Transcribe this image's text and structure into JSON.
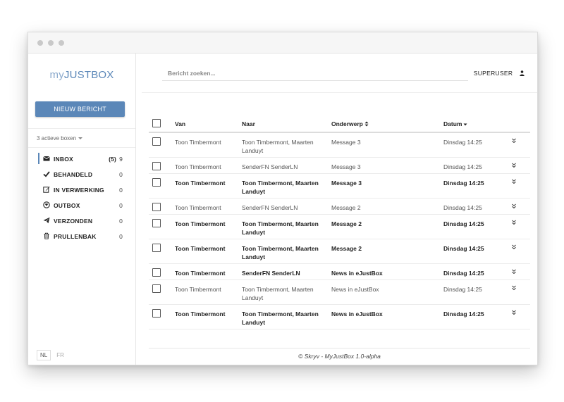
{
  "sidebar": {
    "logo_prefix": "my",
    "logo_main": "JUSTBOX",
    "new_button": "NIEUW BERICHT",
    "boxes_label": "3 actieve boxen",
    "items": [
      {
        "label": "INBOX",
        "unread": "(5)",
        "count": "9",
        "icon": "envelope-icon"
      },
      {
        "label": "BEHANDELD",
        "unread": "",
        "count": "0",
        "icon": "check-icon"
      },
      {
        "label": "IN VERWERKING",
        "unread": "",
        "count": "0",
        "icon": "edit-icon"
      },
      {
        "label": "OUTBOX",
        "unread": "",
        "count": "0",
        "icon": "arrow-circle-icon"
      },
      {
        "label": "VERZONDEN",
        "unread": "",
        "count": "0",
        "icon": "paper-plane-icon"
      },
      {
        "label": "PRULLENBAK",
        "unread": "",
        "count": "0",
        "icon": "trash-icon"
      }
    ],
    "languages": [
      "NL",
      "FR"
    ]
  },
  "header": {
    "search_placeholder": "Bericht zoeken...",
    "user": "SUPERUSER"
  },
  "table": {
    "columns": {
      "from": "Van",
      "to": "Naar",
      "subject": "Onderwerp",
      "date": "Datum"
    },
    "rows": [
      {
        "from": "Toon Timbermont",
        "to": "Toon Timbermont, Maarten Landuyt",
        "subject": "Message 3",
        "date": "Dinsdag 14:25",
        "unread": false
      },
      {
        "from": "Toon Timbermont",
        "to": "SenderFN SenderLN",
        "subject": "Message 3",
        "date": "Dinsdag 14:25",
        "unread": false
      },
      {
        "from": "Toon Timbermont",
        "to": "Toon Timbermont, Maarten Landuyt",
        "subject": "Message 3",
        "date": "Dinsdag 14:25",
        "unread": true
      },
      {
        "from": "Toon Timbermont",
        "to": "SenderFN SenderLN",
        "subject": "Message 2",
        "date": "Dinsdag 14:25",
        "unread": false
      },
      {
        "from": "Toon Timbermont",
        "to": "Toon Timbermont, Maarten Landuyt",
        "subject": "Message 2",
        "date": "Dinsdag 14:25",
        "unread": true
      },
      {
        "from": "Toon Timbermont",
        "to": "Toon Timbermont, Maarten Landuyt",
        "subject": "Message 2",
        "date": "Dinsdag 14:25",
        "unread": true
      },
      {
        "from": "Toon Timbermont",
        "to": "SenderFN SenderLN",
        "subject": "News in eJustBox",
        "date": "Dinsdag 14:25",
        "unread": true
      },
      {
        "from": "Toon Timbermont",
        "to": "Toon Timbermont, Maarten Landuyt",
        "subject": "News in eJustBox",
        "date": "Dinsdag 14:25",
        "unread": false
      },
      {
        "from": "Toon Timbermont",
        "to": "Toon Timbermont, Maarten Landuyt",
        "subject": "News in eJustBox",
        "date": "Dinsdag 14:25",
        "unread": true
      }
    ]
  },
  "footer": "© Skryv - MyJustBox 1.0-alpha",
  "colors": {
    "accent": "#5b87b8"
  }
}
